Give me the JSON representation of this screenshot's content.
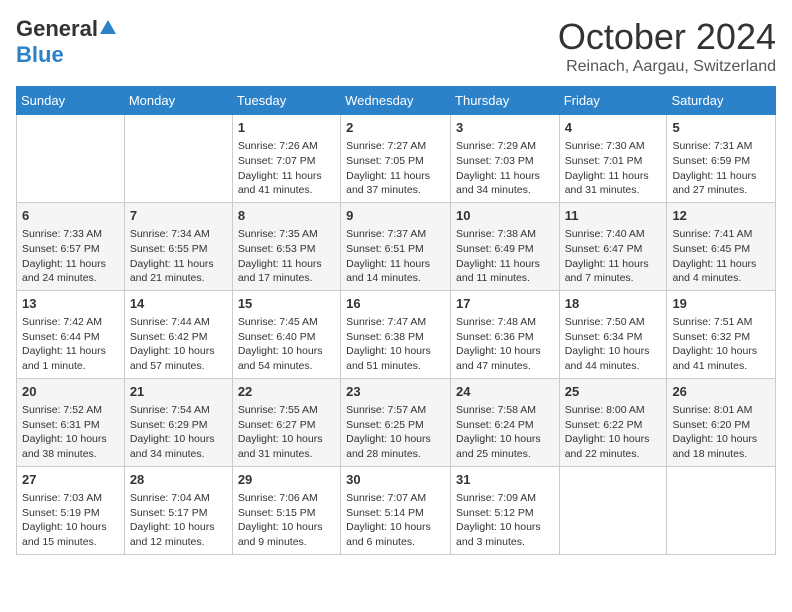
{
  "header": {
    "logo_general": "General",
    "logo_blue": "Blue",
    "title": "October 2024",
    "location": "Reinach, Aargau, Switzerland"
  },
  "weekdays": [
    "Sunday",
    "Monday",
    "Tuesday",
    "Wednesday",
    "Thursday",
    "Friday",
    "Saturday"
  ],
  "weeks": [
    [
      {
        "day": "",
        "sunrise": "",
        "sunset": "",
        "daylight": ""
      },
      {
        "day": "",
        "sunrise": "",
        "sunset": "",
        "daylight": ""
      },
      {
        "day": "1",
        "sunrise": "Sunrise: 7:26 AM",
        "sunset": "Sunset: 7:07 PM",
        "daylight": "Daylight: 11 hours and 41 minutes."
      },
      {
        "day": "2",
        "sunrise": "Sunrise: 7:27 AM",
        "sunset": "Sunset: 7:05 PM",
        "daylight": "Daylight: 11 hours and 37 minutes."
      },
      {
        "day": "3",
        "sunrise": "Sunrise: 7:29 AM",
        "sunset": "Sunset: 7:03 PM",
        "daylight": "Daylight: 11 hours and 34 minutes."
      },
      {
        "day": "4",
        "sunrise": "Sunrise: 7:30 AM",
        "sunset": "Sunset: 7:01 PM",
        "daylight": "Daylight: 11 hours and 31 minutes."
      },
      {
        "day": "5",
        "sunrise": "Sunrise: 7:31 AM",
        "sunset": "Sunset: 6:59 PM",
        "daylight": "Daylight: 11 hours and 27 minutes."
      }
    ],
    [
      {
        "day": "6",
        "sunrise": "Sunrise: 7:33 AM",
        "sunset": "Sunset: 6:57 PM",
        "daylight": "Daylight: 11 hours and 24 minutes."
      },
      {
        "day": "7",
        "sunrise": "Sunrise: 7:34 AM",
        "sunset": "Sunset: 6:55 PM",
        "daylight": "Daylight: 11 hours and 21 minutes."
      },
      {
        "day": "8",
        "sunrise": "Sunrise: 7:35 AM",
        "sunset": "Sunset: 6:53 PM",
        "daylight": "Daylight: 11 hours and 17 minutes."
      },
      {
        "day": "9",
        "sunrise": "Sunrise: 7:37 AM",
        "sunset": "Sunset: 6:51 PM",
        "daylight": "Daylight: 11 hours and 14 minutes."
      },
      {
        "day": "10",
        "sunrise": "Sunrise: 7:38 AM",
        "sunset": "Sunset: 6:49 PM",
        "daylight": "Daylight: 11 hours and 11 minutes."
      },
      {
        "day": "11",
        "sunrise": "Sunrise: 7:40 AM",
        "sunset": "Sunset: 6:47 PM",
        "daylight": "Daylight: 11 hours and 7 minutes."
      },
      {
        "day": "12",
        "sunrise": "Sunrise: 7:41 AM",
        "sunset": "Sunset: 6:45 PM",
        "daylight": "Daylight: 11 hours and 4 minutes."
      }
    ],
    [
      {
        "day": "13",
        "sunrise": "Sunrise: 7:42 AM",
        "sunset": "Sunset: 6:44 PM",
        "daylight": "Daylight: 11 hours and 1 minute."
      },
      {
        "day": "14",
        "sunrise": "Sunrise: 7:44 AM",
        "sunset": "Sunset: 6:42 PM",
        "daylight": "Daylight: 10 hours and 57 minutes."
      },
      {
        "day": "15",
        "sunrise": "Sunrise: 7:45 AM",
        "sunset": "Sunset: 6:40 PM",
        "daylight": "Daylight: 10 hours and 54 minutes."
      },
      {
        "day": "16",
        "sunrise": "Sunrise: 7:47 AM",
        "sunset": "Sunset: 6:38 PM",
        "daylight": "Daylight: 10 hours and 51 minutes."
      },
      {
        "day": "17",
        "sunrise": "Sunrise: 7:48 AM",
        "sunset": "Sunset: 6:36 PM",
        "daylight": "Daylight: 10 hours and 47 minutes."
      },
      {
        "day": "18",
        "sunrise": "Sunrise: 7:50 AM",
        "sunset": "Sunset: 6:34 PM",
        "daylight": "Daylight: 10 hours and 44 minutes."
      },
      {
        "day": "19",
        "sunrise": "Sunrise: 7:51 AM",
        "sunset": "Sunset: 6:32 PM",
        "daylight": "Daylight: 10 hours and 41 minutes."
      }
    ],
    [
      {
        "day": "20",
        "sunrise": "Sunrise: 7:52 AM",
        "sunset": "Sunset: 6:31 PM",
        "daylight": "Daylight: 10 hours and 38 minutes."
      },
      {
        "day": "21",
        "sunrise": "Sunrise: 7:54 AM",
        "sunset": "Sunset: 6:29 PM",
        "daylight": "Daylight: 10 hours and 34 minutes."
      },
      {
        "day": "22",
        "sunrise": "Sunrise: 7:55 AM",
        "sunset": "Sunset: 6:27 PM",
        "daylight": "Daylight: 10 hours and 31 minutes."
      },
      {
        "day": "23",
        "sunrise": "Sunrise: 7:57 AM",
        "sunset": "Sunset: 6:25 PM",
        "daylight": "Daylight: 10 hours and 28 minutes."
      },
      {
        "day": "24",
        "sunrise": "Sunrise: 7:58 AM",
        "sunset": "Sunset: 6:24 PM",
        "daylight": "Daylight: 10 hours and 25 minutes."
      },
      {
        "day": "25",
        "sunrise": "Sunrise: 8:00 AM",
        "sunset": "Sunset: 6:22 PM",
        "daylight": "Daylight: 10 hours and 22 minutes."
      },
      {
        "day": "26",
        "sunrise": "Sunrise: 8:01 AM",
        "sunset": "Sunset: 6:20 PM",
        "daylight": "Daylight: 10 hours and 18 minutes."
      }
    ],
    [
      {
        "day": "27",
        "sunrise": "Sunrise: 7:03 AM",
        "sunset": "Sunset: 5:19 PM",
        "daylight": "Daylight: 10 hours and 15 minutes."
      },
      {
        "day": "28",
        "sunrise": "Sunrise: 7:04 AM",
        "sunset": "Sunset: 5:17 PM",
        "daylight": "Daylight: 10 hours and 12 minutes."
      },
      {
        "day": "29",
        "sunrise": "Sunrise: 7:06 AM",
        "sunset": "Sunset: 5:15 PM",
        "daylight": "Daylight: 10 hours and 9 minutes."
      },
      {
        "day": "30",
        "sunrise": "Sunrise: 7:07 AM",
        "sunset": "Sunset: 5:14 PM",
        "daylight": "Daylight: 10 hours and 6 minutes."
      },
      {
        "day": "31",
        "sunrise": "Sunrise: 7:09 AM",
        "sunset": "Sunset: 5:12 PM",
        "daylight": "Daylight: 10 hours and 3 minutes."
      },
      {
        "day": "",
        "sunrise": "",
        "sunset": "",
        "daylight": ""
      },
      {
        "day": "",
        "sunrise": "",
        "sunset": "",
        "daylight": ""
      }
    ]
  ]
}
